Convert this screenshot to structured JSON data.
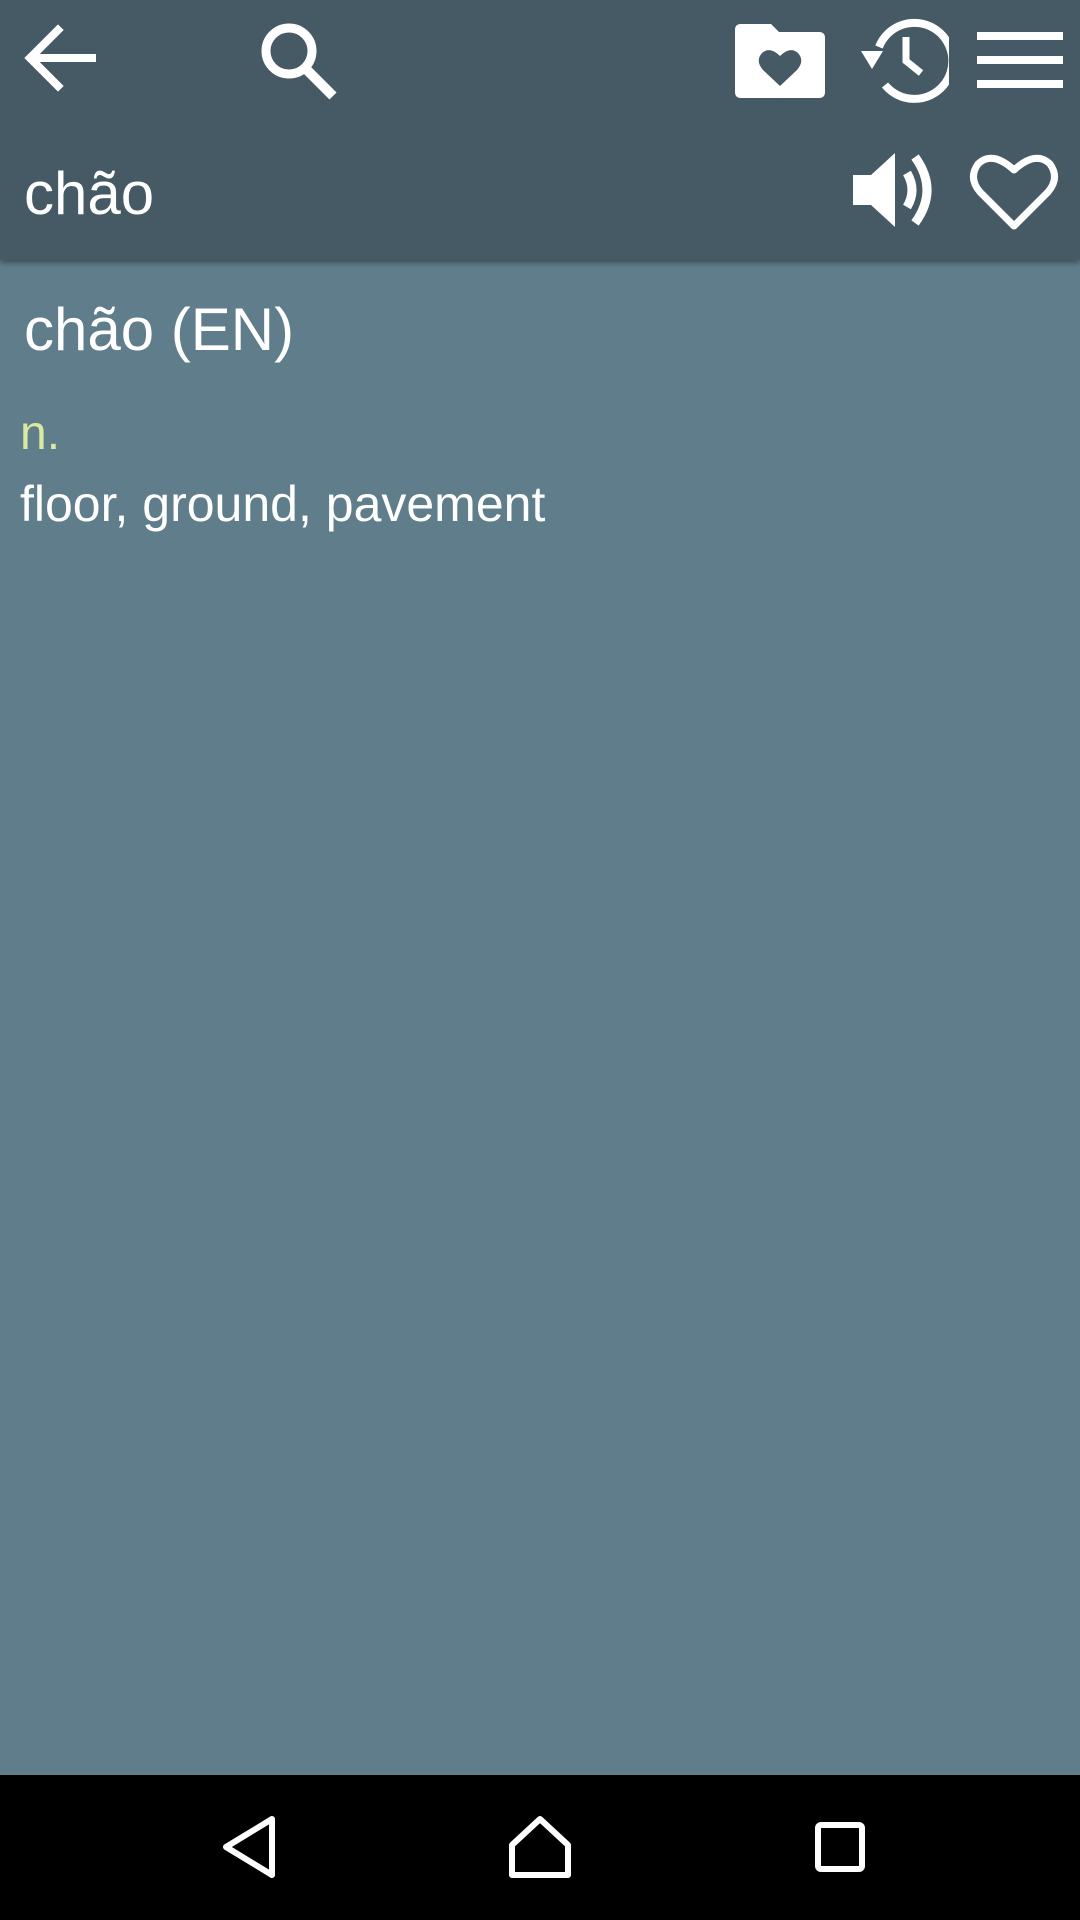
{
  "toolbar": {
    "icons": {
      "back": "arrow-left",
      "search": "magnifier",
      "favorites_folder": "folder-heart",
      "history": "clock-history",
      "menu": "hamburger",
      "speaker": "volume-up",
      "favorite": "heart-outline"
    },
    "word": "chão"
  },
  "entry": {
    "heading": "chão (EN)",
    "part_of_speech": "n.",
    "translation": "floor, ground, pavement"
  },
  "navbar": {
    "icons": {
      "back": "triangle-back",
      "home": "house",
      "recents": "square"
    }
  },
  "colors": {
    "toolbar_bg": "#455a64",
    "content_bg": "#607d8b",
    "pos_text": "#dce7a0",
    "text": "#ffffff",
    "navbar_bg": "#000000"
  }
}
